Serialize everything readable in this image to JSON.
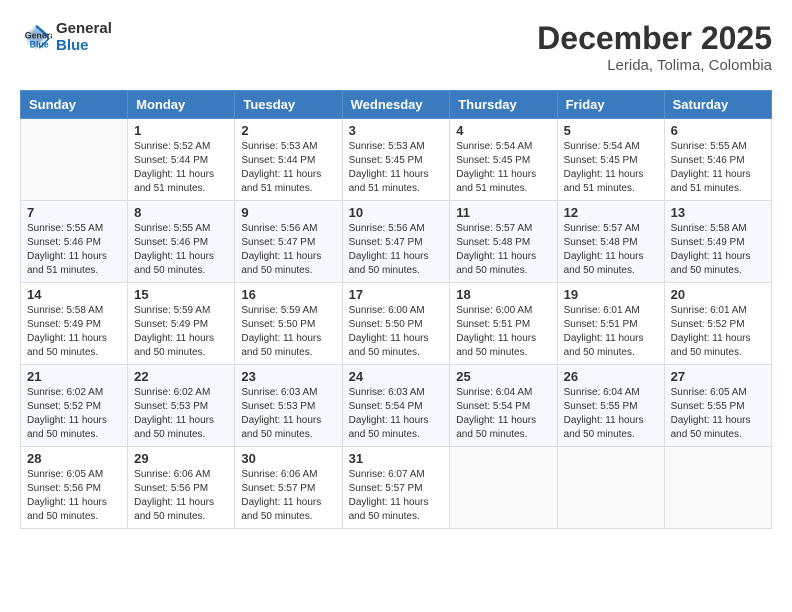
{
  "header": {
    "logo_line1": "General",
    "logo_line2": "Blue",
    "month": "December 2025",
    "location": "Lerida, Tolima, Colombia"
  },
  "weekdays": [
    "Sunday",
    "Monday",
    "Tuesday",
    "Wednesday",
    "Thursday",
    "Friday",
    "Saturday"
  ],
  "weeks": [
    [
      {
        "day": "",
        "sunrise": "",
        "sunset": "",
        "daylight": ""
      },
      {
        "day": "1",
        "sunrise": "5:52 AM",
        "sunset": "5:44 PM",
        "daylight": "11 hours and 51 minutes."
      },
      {
        "day": "2",
        "sunrise": "5:53 AM",
        "sunset": "5:44 PM",
        "daylight": "11 hours and 51 minutes."
      },
      {
        "day": "3",
        "sunrise": "5:53 AM",
        "sunset": "5:45 PM",
        "daylight": "11 hours and 51 minutes."
      },
      {
        "day": "4",
        "sunrise": "5:54 AM",
        "sunset": "5:45 PM",
        "daylight": "11 hours and 51 minutes."
      },
      {
        "day": "5",
        "sunrise": "5:54 AM",
        "sunset": "5:45 PM",
        "daylight": "11 hours and 51 minutes."
      },
      {
        "day": "6",
        "sunrise": "5:55 AM",
        "sunset": "5:46 PM",
        "daylight": "11 hours and 51 minutes."
      }
    ],
    [
      {
        "day": "7",
        "sunrise": "5:55 AM",
        "sunset": "5:46 PM",
        "daylight": "11 hours and 51 minutes."
      },
      {
        "day": "8",
        "sunrise": "5:55 AM",
        "sunset": "5:46 PM",
        "daylight": "11 hours and 50 minutes."
      },
      {
        "day": "9",
        "sunrise": "5:56 AM",
        "sunset": "5:47 PM",
        "daylight": "11 hours and 50 minutes."
      },
      {
        "day": "10",
        "sunrise": "5:56 AM",
        "sunset": "5:47 PM",
        "daylight": "11 hours and 50 minutes."
      },
      {
        "day": "11",
        "sunrise": "5:57 AM",
        "sunset": "5:48 PM",
        "daylight": "11 hours and 50 minutes."
      },
      {
        "day": "12",
        "sunrise": "5:57 AM",
        "sunset": "5:48 PM",
        "daylight": "11 hours and 50 minutes."
      },
      {
        "day": "13",
        "sunrise": "5:58 AM",
        "sunset": "5:49 PM",
        "daylight": "11 hours and 50 minutes."
      }
    ],
    [
      {
        "day": "14",
        "sunrise": "5:58 AM",
        "sunset": "5:49 PM",
        "daylight": "11 hours and 50 minutes."
      },
      {
        "day": "15",
        "sunrise": "5:59 AM",
        "sunset": "5:49 PM",
        "daylight": "11 hours and 50 minutes."
      },
      {
        "day": "16",
        "sunrise": "5:59 AM",
        "sunset": "5:50 PM",
        "daylight": "11 hours and 50 minutes."
      },
      {
        "day": "17",
        "sunrise": "6:00 AM",
        "sunset": "5:50 PM",
        "daylight": "11 hours and 50 minutes."
      },
      {
        "day": "18",
        "sunrise": "6:00 AM",
        "sunset": "5:51 PM",
        "daylight": "11 hours and 50 minutes."
      },
      {
        "day": "19",
        "sunrise": "6:01 AM",
        "sunset": "5:51 PM",
        "daylight": "11 hours and 50 minutes."
      },
      {
        "day": "20",
        "sunrise": "6:01 AM",
        "sunset": "5:52 PM",
        "daylight": "11 hours and 50 minutes."
      }
    ],
    [
      {
        "day": "21",
        "sunrise": "6:02 AM",
        "sunset": "5:52 PM",
        "daylight": "11 hours and 50 minutes."
      },
      {
        "day": "22",
        "sunrise": "6:02 AM",
        "sunset": "5:53 PM",
        "daylight": "11 hours and 50 minutes."
      },
      {
        "day": "23",
        "sunrise": "6:03 AM",
        "sunset": "5:53 PM",
        "daylight": "11 hours and 50 minutes."
      },
      {
        "day": "24",
        "sunrise": "6:03 AM",
        "sunset": "5:54 PM",
        "daylight": "11 hours and 50 minutes."
      },
      {
        "day": "25",
        "sunrise": "6:04 AM",
        "sunset": "5:54 PM",
        "daylight": "11 hours and 50 minutes."
      },
      {
        "day": "26",
        "sunrise": "6:04 AM",
        "sunset": "5:55 PM",
        "daylight": "11 hours and 50 minutes."
      },
      {
        "day": "27",
        "sunrise": "6:05 AM",
        "sunset": "5:55 PM",
        "daylight": "11 hours and 50 minutes."
      }
    ],
    [
      {
        "day": "28",
        "sunrise": "6:05 AM",
        "sunset": "5:56 PM",
        "daylight": "11 hours and 50 minutes."
      },
      {
        "day": "29",
        "sunrise": "6:06 AM",
        "sunset": "5:56 PM",
        "daylight": "11 hours and 50 minutes."
      },
      {
        "day": "30",
        "sunrise": "6:06 AM",
        "sunset": "5:57 PM",
        "daylight": "11 hours and 50 minutes."
      },
      {
        "day": "31",
        "sunrise": "6:07 AM",
        "sunset": "5:57 PM",
        "daylight": "11 hours and 50 minutes."
      },
      {
        "day": "",
        "sunrise": "",
        "sunset": "",
        "daylight": ""
      },
      {
        "day": "",
        "sunrise": "",
        "sunset": "",
        "daylight": ""
      },
      {
        "day": "",
        "sunrise": "",
        "sunset": "",
        "daylight": ""
      }
    ]
  ]
}
